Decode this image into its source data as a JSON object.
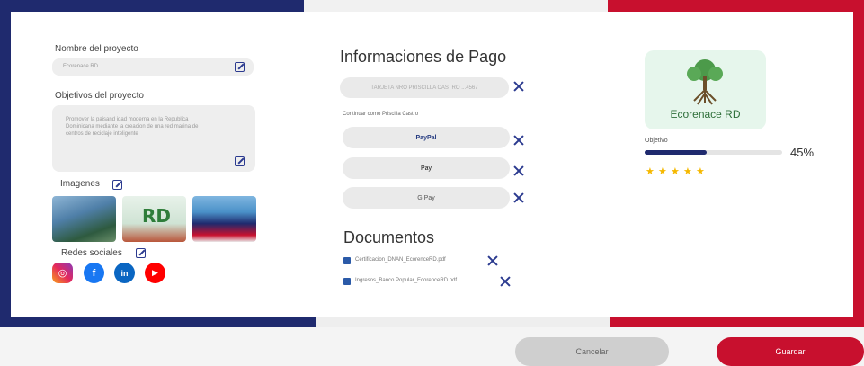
{
  "left": {
    "project_name_label": "Nombre  del proyecto",
    "project_name_value": "Ecorenace RD",
    "objectives_label": "Objetivos del proyecto",
    "objectives_value": "Promover la paisand idad moderna en la Republica Dominicana mediante la creacion de una red marina de centros de reciclaje inteligente",
    "images_label": "Imagenes",
    "social_label": "Redes sociales",
    "social": [
      "instagram-icon",
      "facebook-icon",
      "linkedin-icon",
      "youtube-icon"
    ]
  },
  "payment": {
    "title": "Informaciones de Pago",
    "card_text": "TARJETA NRO PRISCILLA CASTRO       ...4567",
    "note": "Continuar como Priscilla Castro",
    "methods": [
      "PayPal",
      "Pay",
      "G Pay"
    ]
  },
  "documents": {
    "title": "Documentos",
    "files": [
      "Certificacion_DNAN_EcorenceRD.pdf",
      "Ingresos_Banco Popular_EcorenceRD.pdf"
    ]
  },
  "summary": {
    "logo_text": "Ecorenace RD",
    "objective_label": "Objetivo",
    "progress_text": "45%",
    "progress_fraction": 0.45,
    "stars": 5,
    "star_glyph": "★"
  },
  "buttons": {
    "cancel": "Cancelar",
    "save": "Guardar"
  },
  "colors": {
    "blue": "#1f2a6e",
    "red": "#c8102e",
    "icon": "#2b3a8f",
    "star": "#f5b800"
  }
}
